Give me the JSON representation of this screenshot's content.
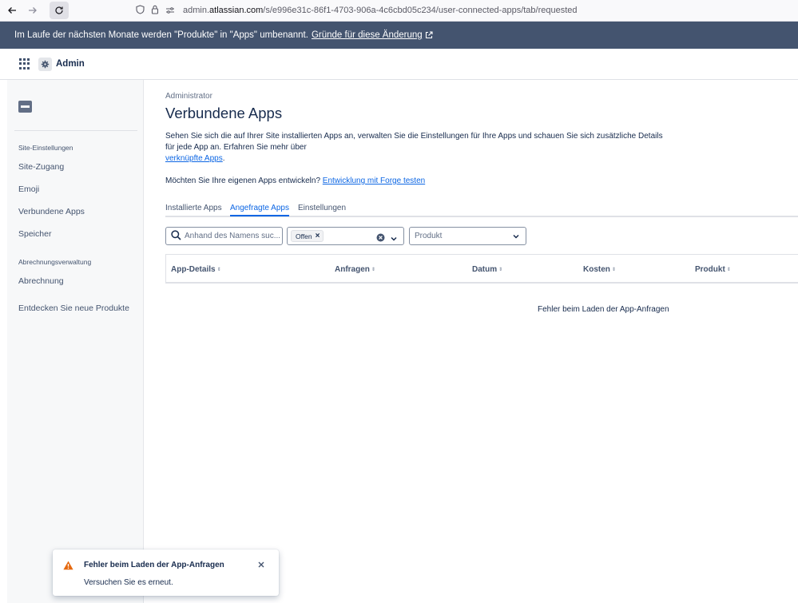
{
  "browser": {
    "url_prefix": "admin.",
    "url_domain": "atlassian.com",
    "url_path": "/s/e996e31c-86f1-4703-906a-4c6cbd05c234/user-connected-apps/tab/requested"
  },
  "banner": {
    "text": "Im Laufe der nächsten Monate werden \"Produkte\" in \"Apps\" umbenannt.",
    "link": "Gründe für diese Änderung"
  },
  "topnav": {
    "app_name": "Admin"
  },
  "sidebar": {
    "section_site": "Site-Einstellungen",
    "items": [
      "Site-Zugang",
      "Emoji",
      "Verbundene Apps",
      "Speicher"
    ],
    "section_billing": "Abrechnungsverwaltung",
    "billing": "Abrechnung",
    "discover": "Entdecken Sie neue Produkte"
  },
  "main": {
    "breadcrumb": "Administrator",
    "title": "Verbundene Apps",
    "description_1": "Sehen Sie sich die auf Ihrer Site installierten Apps an, verwalten Sie die Einstellungen für Ihre Apps und schauen Sie sich zusätzliche Details für jede App an. Erfahren Sie mehr über",
    "description_link": "verknüpfte Apps",
    "description_end": ".",
    "forge_text": "Möchten Sie Ihre eigenen Apps entwickeln?",
    "forge_link": "Entwicklung mit Forge testen",
    "tabs": [
      "Installierte Apps",
      "Angefragte Apps",
      "Einstellungen"
    ],
    "search_placeholder": "Anhand des Namens suc...",
    "status_chip": "Offen",
    "product_placeholder": "Produkt",
    "columns": [
      "App-Details",
      "Anfragen",
      "Datum",
      "Kosten",
      "Produkt"
    ],
    "error": "Fehler beim Laden der App-Anfragen"
  },
  "toast": {
    "title": "Fehler beim Laden der App-Anfragen",
    "body": "Versuchen Sie es erneut."
  },
  "colors": {
    "banner": "#44546f",
    "link": "#0c66e4",
    "warning": "#e56910"
  }
}
